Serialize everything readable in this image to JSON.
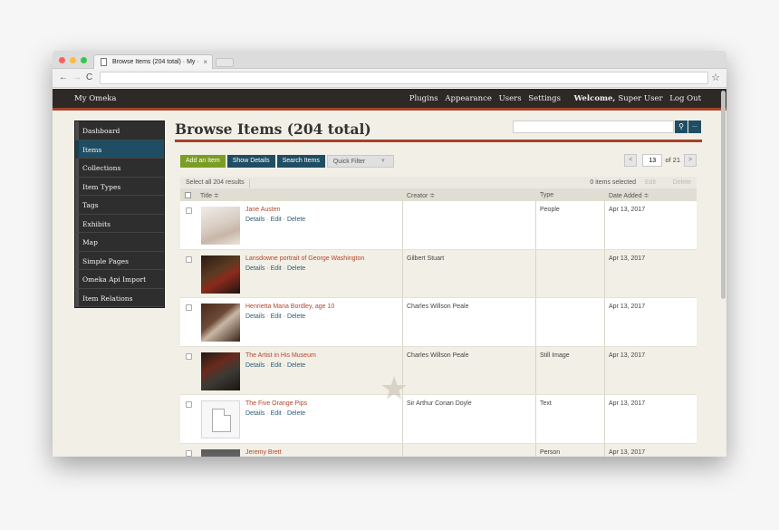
{
  "browser": {
    "tab_title": "Browse Items (204 total) · My ·",
    "tab_close": "×",
    "back_icon": "←",
    "forward_icon": "→",
    "reload_icon": "C",
    "bookmark_icon": "☆",
    "url": ""
  },
  "topnav": {
    "site_title": "My Omeka",
    "links": [
      "Plugins",
      "Appearance",
      "Users",
      "Settings"
    ],
    "welcome": "Welcome,",
    "user": "Super User",
    "logout": "Log Out"
  },
  "sidebar": {
    "items": [
      {
        "label": "Dashboard"
      },
      {
        "label": "Items"
      },
      {
        "label": "Collections"
      },
      {
        "label": "Item Types"
      },
      {
        "label": "Tags"
      },
      {
        "label": "Exhibits"
      },
      {
        "label": "Map"
      },
      {
        "label": "Simple Pages"
      },
      {
        "label": "Omeka Api Import"
      },
      {
        "label": "Item Relations"
      }
    ],
    "active": "Items"
  },
  "main": {
    "title": "Browse Items (204 total)",
    "search": {
      "placeholder": "",
      "button_icon": "search-icon",
      "more_label": "..."
    },
    "buttons": {
      "add": "Add an Item",
      "details": "Show Details",
      "search": "Search Items",
      "filter": "Quick Filter"
    },
    "pagination": {
      "prev": "<",
      "current": "13",
      "total_label": "of 21",
      "next": ">"
    },
    "selection": {
      "select_all": "Select all 204 results",
      "count": "0 items selected",
      "edit": "Edit",
      "delete": "Delete"
    },
    "columns": {
      "title": "Title ≑",
      "creator": "Creator ≑",
      "type": "Type",
      "date": "Date Added ≑"
    },
    "actions": {
      "details": "Details",
      "edit": "Edit",
      "delete": "Delete",
      "sep": " · "
    },
    "rows": [
      {
        "title": "Jane Austen",
        "creator": "",
        "type": "People",
        "date": "Apr 13, 2017"
      },
      {
        "title": "Lansdowne portrait of George Washington",
        "creator": "Gilbert Stuart",
        "type": "",
        "date": "Apr 13, 2017"
      },
      {
        "title": "Henrietta Maria Bordley, age 10",
        "creator": "Charles Willson Peale",
        "type": "",
        "date": "Apr 13, 2017"
      },
      {
        "title": "The Artist in His Museum",
        "creator": "Charles Willson Peale",
        "type": "Still Image",
        "date": "Apr 13, 2017"
      },
      {
        "title": "The Five Orange Pips",
        "creator": "Sir Arthur Conan Doyle",
        "type": "Text",
        "date": "Apr 13, 2017"
      },
      {
        "title": "Jeremy Brett",
        "creator": "",
        "type": "Person",
        "date": "Apr 13, 2017"
      }
    ],
    "watermark_icon": "star-icon"
  },
  "colors": {
    "nav_bg": "#2e2925",
    "accent": "#a5432a",
    "primary": "#1f4e64",
    "success": "#7a9e23",
    "link": "#b5452b"
  }
}
